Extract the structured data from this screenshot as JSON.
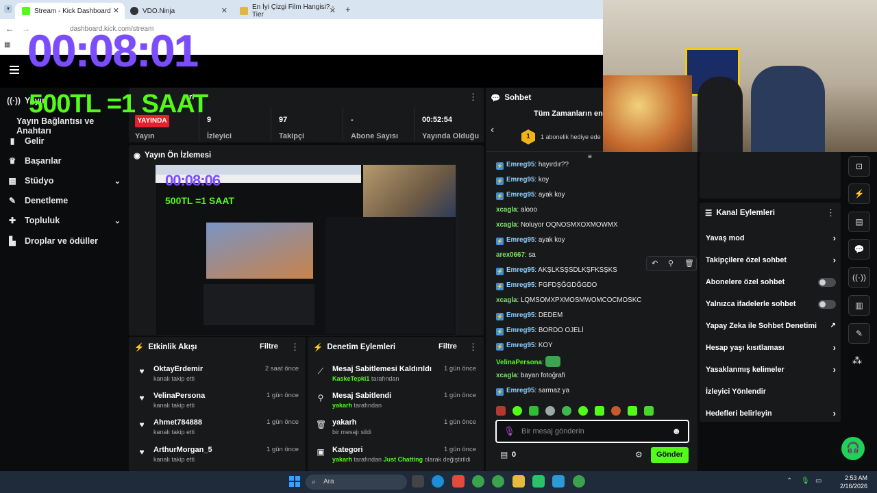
{
  "browser": {
    "tabs": [
      {
        "title": "Stream - Kick Dashboard"
      },
      {
        "title": "VDO.Ninja"
      },
      {
        "title": "En İyi Çizgi Film Hangisi? - Tier"
      }
    ],
    "url": "dashboard.kick.com/stream"
  },
  "overlay": {
    "timer": "00:08:01",
    "promo": "500TL =1 SAAT"
  },
  "sidebar": {
    "items": [
      {
        "label": "Yayın",
        "icon": "broadcast-icon"
      },
      {
        "label": "Yayın Bağlantısı ve Anahtarı",
        "icon": ""
      },
      {
        "label": "Gelir",
        "icon": "bar-chart-icon"
      },
      {
        "label": "Başarılar",
        "icon": "trophy-icon"
      },
      {
        "label": "Stüdyo",
        "icon": "grid-icon"
      },
      {
        "label": "Denetleme",
        "icon": "wrench-icon"
      },
      {
        "label": "Topluluk",
        "icon": "puzzle-icon"
      },
      {
        "label": "Droplar ve ödüller",
        "icon": "drops-icon"
      }
    ]
  },
  "stream_info": {
    "title_partial": "ri",
    "status": "YAYINDA",
    "status_label": "Yayın",
    "stats": [
      {
        "value": "9",
        "label": "İzleyici"
      },
      {
        "value": "97",
        "label": "Takipçi"
      },
      {
        "value": "-",
        "label": "Abone Sayısı"
      },
      {
        "value": "00:52:54",
        "label": "Yayında Olduğu"
      }
    ]
  },
  "preview": {
    "title": "Yayın Ön İzlemesi",
    "inner_timer": "00:08:06",
    "inner_promo": "500TL =1 SAAT"
  },
  "activity": {
    "title": "Etkinlik Akışı",
    "filter": "Filtre",
    "items": [
      {
        "name": "OktayErdemir",
        "sub": "kanalı takip etti",
        "time": "2 saat önce"
      },
      {
        "name": "VelinaPersona",
        "sub": "kanalı takip etti",
        "time": "1 gün önce"
      },
      {
        "name": "Ahmet784888",
        "sub": "kanalı takip etti",
        "time": "1 gün önce"
      },
      {
        "name": "ArthurMorgan_5",
        "sub": "kanalı takip etti",
        "time": "1 gün önce"
      }
    ]
  },
  "moderation": {
    "title": "Denetim Eylemleri",
    "filter": "Filtre",
    "items": [
      {
        "title": "Mesaj Sabitlemesi Kaldırıldı",
        "user": "KaskeTepki1",
        "rest": " tarafından",
        "time": "1 gün önce"
      },
      {
        "title": "Mesaj Sabitlendi",
        "user": "yakarh",
        "rest": " tarafından",
        "time": "1 gün önce"
      },
      {
        "title": "yakarh",
        "user": "",
        "rest": "bir mesajı sildi",
        "time": "1 gün önce"
      },
      {
        "title": "Kategori",
        "user": "yakarh",
        "rest": " tarafından ",
        "category": "Just Chatting",
        "rest2": " olarak değiştirildi",
        "time": "1 gün önce"
      }
    ]
  },
  "chat": {
    "title": "Sohbet",
    "leaderboard_title": "Tüm Zamanların en i",
    "gift_text": "1 abonelik hediye ede",
    "gift_rank": "1",
    "messages": [
      {
        "user": "Emreg95",
        "text": "hayırdır??",
        "color": "#8fd0ff",
        "badge": true
      },
      {
        "user": "Emreg95",
        "text": "koy",
        "color": "#8fd0ff",
        "badge": true
      },
      {
        "user": "Emreg95",
        "text": "ayak koy",
        "color": "#8fd0ff",
        "badge": true
      },
      {
        "user": "xcagla",
        "text": "alooo",
        "color": "#7de36d",
        "badge": false
      },
      {
        "user": "xcagla",
        "text": "Noluyor OQNOSMXOXMOWMX",
        "color": "#7de36d",
        "badge": false
      },
      {
        "user": "Emreg95",
        "text": "ayak koy",
        "color": "#8fd0ff",
        "badge": true
      },
      {
        "user": "arex0667",
        "text": "sa",
        "color": "#7de36d",
        "badge": false
      },
      {
        "user": "Emreg95",
        "text": "AKŞLKSŞSDLKŞFKSŞKS",
        "color": "#8fd0ff",
        "badge": true
      },
      {
        "user": "Emreg95",
        "text": "FGFDŞĞGDĞGDO",
        "color": "#8fd0ff",
        "badge": true
      },
      {
        "user": "xcagla",
        "text": "LQMSOMXPXMOSMWOMCOCMOSKC",
        "color": "#7de36d",
        "badge": false
      },
      {
        "user": "Emreg95",
        "text": "DEDEM",
        "color": "#8fd0ff",
        "badge": true
      },
      {
        "user": "Emreg95",
        "text": "BORDO OJELİ",
        "color": "#8fd0ff",
        "badge": true
      },
      {
        "user": "Emreg95",
        "text": "KOY",
        "color": "#8fd0ff",
        "badge": true
      },
      {
        "user": "VelinaPersona",
        "text": "",
        "color": "#53fc18",
        "badge": false
      },
      {
        "user": "xcagla",
        "text": "bayan fotoğrafi",
        "color": "#7de36d",
        "badge": false
      },
      {
        "user": "Emreg95",
        "text": "sarmaz ya",
        "color": "#8fd0ff",
        "badge": true
      }
    ],
    "input_placeholder": "Bir mesaj gönderin",
    "points": "0",
    "send_label": "Gönder"
  },
  "channel_actions": {
    "title": "Kanal Eylemleri",
    "items": [
      {
        "label": "Yavaş mod",
        "control": "chevron"
      },
      {
        "label": "Takipçilere özel sohbet",
        "control": "chevron"
      },
      {
        "label": "Abonelere özel sohbet",
        "control": "toggle"
      },
      {
        "label": "Yalnızca ifadelerle sohbet",
        "control": "toggle"
      },
      {
        "label": "Yapay Zeka ile Sohbet Denetimi",
        "control": "external"
      },
      {
        "label": "Hesap yaşı kısıtlaması",
        "control": "chevron"
      },
      {
        "label": "Yasaklanmış kelimeler",
        "control": "chevron"
      },
      {
        "label": "İzleyici Yönlendir",
        "control": "none"
      },
      {
        "label": "Hedefleri belirleyin",
        "control": "chevron"
      }
    ]
  },
  "taskbar": {
    "search_placeholder": "Ara",
    "time": "2:53 AM",
    "date": "2/16/2026"
  },
  "colors": {
    "kick_green": "#53fc18",
    "live_red": "#e5202b",
    "panel": "#18191b",
    "overlay_purple": "#7c4dff"
  }
}
